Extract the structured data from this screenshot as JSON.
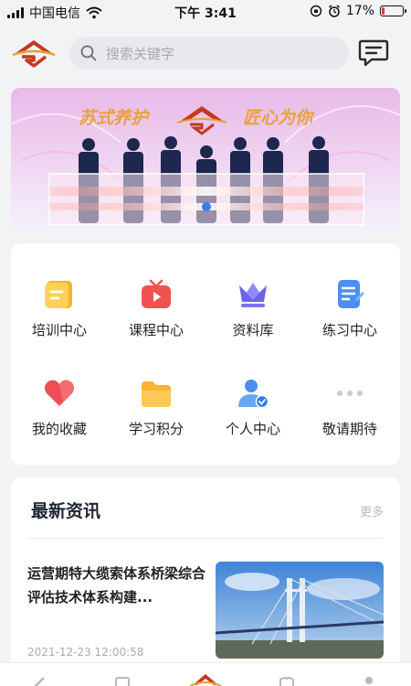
{
  "status_bar": {
    "carrier": "中国电信",
    "time": "下午 3:41",
    "battery_percent": "17%",
    "battery_level": 0.17
  },
  "header": {
    "search_placeholder": "搜索关键字",
    "logo_icon": "brand-logo-icon",
    "message_icon": "message-icon"
  },
  "banner": {
    "slogan_left": "苏式养护",
    "slogan_right": "匠心为你"
  },
  "features": [
    {
      "label": "培训中心",
      "icon": "training-doc-icon",
      "color": "#f5b430"
    },
    {
      "label": "课程中心",
      "icon": "video-course-icon",
      "color": "#ef5350"
    },
    {
      "label": "资料库",
      "icon": "crown-library-icon",
      "color": "#6c63e8"
    },
    {
      "label": "练习中心",
      "icon": "exercise-doc-icon",
      "color": "#4a90f0"
    },
    {
      "label": "我的收藏",
      "icon": "heart-favorite-icon",
      "color": "#ef4e54"
    },
    {
      "label": "学习积分",
      "icon": "folder-points-icon",
      "color": "#f7b531"
    },
    {
      "label": "个人中心",
      "icon": "user-profile-icon",
      "color": "#4a8ff0"
    },
    {
      "label": "敬请期待",
      "icon": "more-dots-icon",
      "color": "#c7cad0"
    }
  ],
  "news": {
    "title": "最新资讯",
    "more_label": "更多",
    "articles": [
      {
        "title": "运营期特大缆索体系桥梁综合评估技术体系构建...",
        "date": "2021-12-23 12:00:58"
      }
    ]
  },
  "colors": {
    "brand_red": "#c4391f",
    "brand_gold": "#e7a036",
    "background": "#f2f3f5"
  }
}
